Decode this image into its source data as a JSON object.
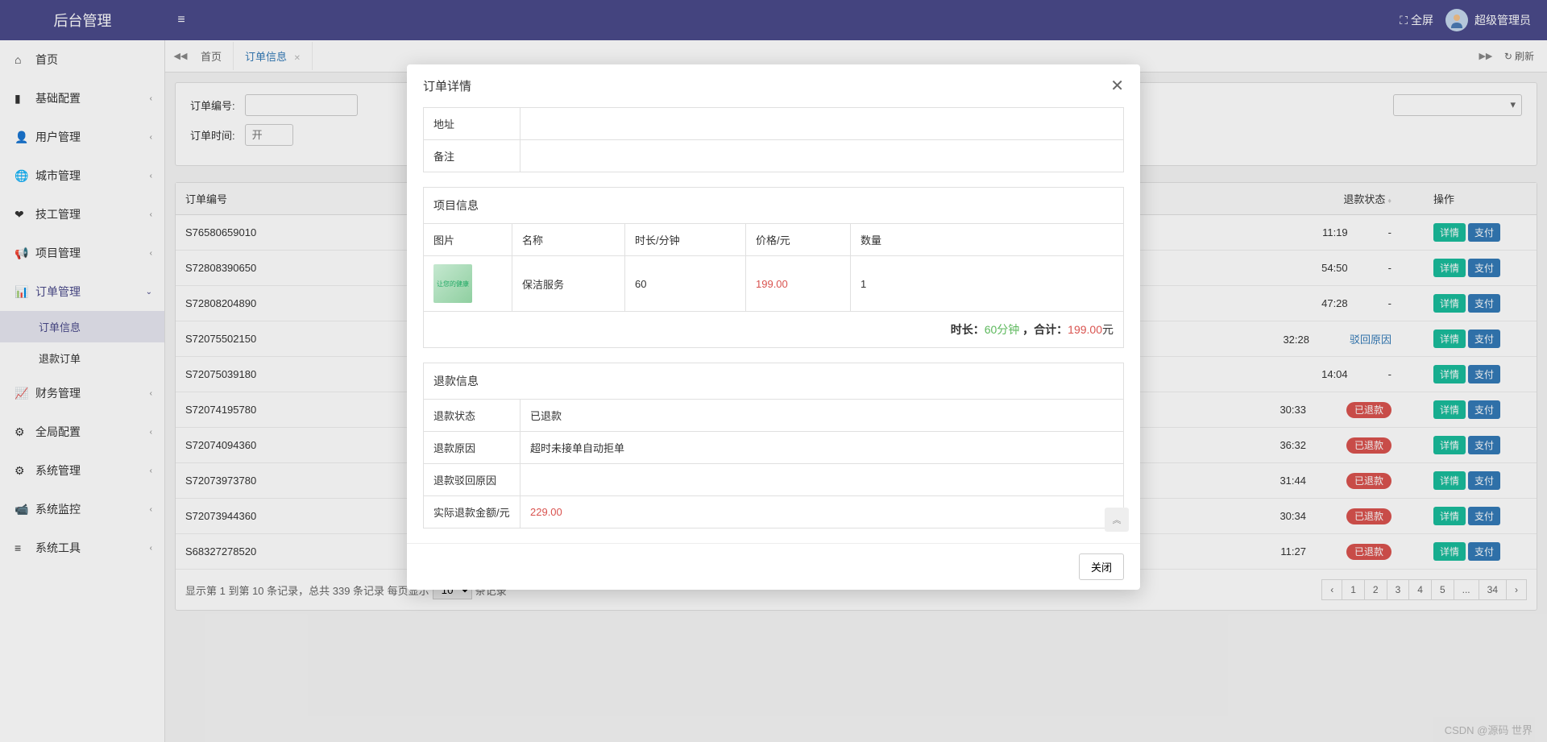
{
  "header": {
    "logo": "后台管理",
    "fullscreen": "全屏",
    "user": "超级管理员"
  },
  "sidebar": {
    "items": [
      {
        "icon": "⌂",
        "label": "首页"
      },
      {
        "icon": "▮",
        "label": "基础配置"
      },
      {
        "icon": "👤",
        "label": "用户管理"
      },
      {
        "icon": "🌐",
        "label": "城市管理"
      },
      {
        "icon": "❤",
        "label": "技工管理"
      },
      {
        "icon": "📢",
        "label": "项目管理"
      },
      {
        "icon": "📊",
        "label": "订单管理"
      },
      {
        "icon": "📈",
        "label": "财务管理"
      },
      {
        "icon": "⚙",
        "label": "全局配置"
      },
      {
        "icon": "⚙",
        "label": "系统管理"
      },
      {
        "icon": "📹",
        "label": "系统监控"
      },
      {
        "icon": "≡",
        "label": "系统工具"
      }
    ],
    "submenu": [
      {
        "label": "订单信息"
      },
      {
        "label": "退款订单"
      }
    ]
  },
  "tabs": {
    "home": "首页",
    "active": "订单信息",
    "refresh": "刷新"
  },
  "filters": {
    "orderNo": "订单编号:",
    "orderTime": "订单时间:",
    "startPlaceholder": "开"
  },
  "table": {
    "headers": {
      "orderNo": "订单编号",
      "refundStatus": "退款状态",
      "action": "操作"
    },
    "rows": [
      {
        "id": "S76580659010",
        "time": "11:19",
        "refund": "-",
        "refundBadge": false
      },
      {
        "id": "S72808390650",
        "time": "54:50",
        "refund": "-",
        "refundBadge": false
      },
      {
        "id": "S72808204890",
        "time": "47:28",
        "refund": "-",
        "refundBadge": false
      },
      {
        "id": "S72075502150",
        "time": "32:28",
        "refund": "驳回原因",
        "refundBadge": false,
        "link": true
      },
      {
        "id": "S72075039180",
        "time": "14:04",
        "refund": "-",
        "refundBadge": false
      },
      {
        "id": "S72074195780",
        "time": "30:33",
        "refund": "已退款",
        "refundBadge": true
      },
      {
        "id": "S72074094360",
        "time": "36:32",
        "refund": "已退款",
        "refundBadge": true
      },
      {
        "id": "S72073973780",
        "time": "31:44",
        "refund": "已退款",
        "refundBadge": true
      },
      {
        "id": "S72073944360",
        "time": "30:34",
        "refund": "已退款",
        "refundBadge": true
      },
      {
        "id": "S68327278520",
        "time": "11:27",
        "refund": "已退款",
        "refundBadge": true
      }
    ],
    "btnDetail": "详情",
    "btnPay": "支付",
    "footer": {
      "text1": "显示第 1 到第 10 条记录，总共 339 条记录  每页显示",
      "pageSize": "10",
      "text2": "条记录",
      "pages": [
        "‹",
        "1",
        "2",
        "3",
        "4",
        "5",
        "...",
        "34",
        "›"
      ]
    }
  },
  "modal": {
    "title": "订单详情",
    "addressLabel": "地址",
    "remarkLabel": "备注",
    "projectSection": "项目信息",
    "projectHeaders": {
      "img": "图片",
      "name": "名称",
      "duration": "时长/分钟",
      "price": "价格/元",
      "qty": "数量"
    },
    "projectRow": {
      "name": "保洁服务",
      "duration": "60",
      "price": "199.00",
      "qty": "1"
    },
    "summary": {
      "durationLabel": "时长：",
      "durationVal": "60分钟",
      "sep": " ，合计：",
      "totalVal": "199.00",
      "unit": "元"
    },
    "refundSection": "退款信息",
    "refund": {
      "statusLabel": "退款状态",
      "statusVal": "已退款",
      "reasonLabel": "退款原因",
      "reasonVal": "超时未接单自动拒单",
      "rejectLabel": "退款驳回原因",
      "rejectVal": "",
      "amountLabel": "实际退款金额/元",
      "amountVal": "229.00"
    },
    "closeBtn": "关闭"
  },
  "watermark": "CSDN @源码 世界"
}
